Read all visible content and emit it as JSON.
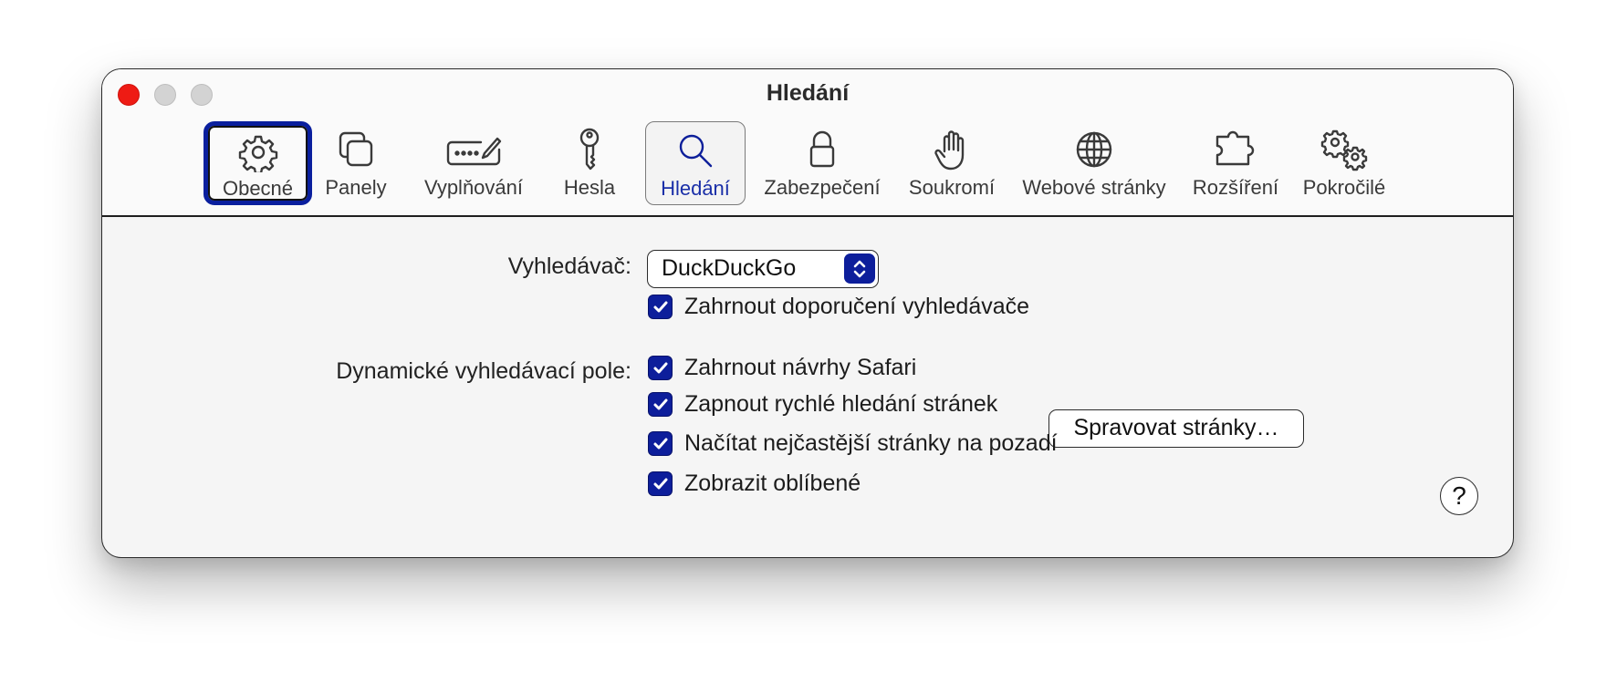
{
  "window": {
    "title": "Hledání"
  },
  "toolbar": {
    "tabs": [
      {
        "label": "Obecné",
        "icon": "gear-icon"
      },
      {
        "label": "Panely",
        "icon": "tabs-icon"
      },
      {
        "label": "Vyplňování",
        "icon": "autofill-icon"
      },
      {
        "label": "Hesla",
        "icon": "key-icon"
      },
      {
        "label": "Hledání",
        "icon": "magnifier-icon"
      },
      {
        "label": "Zabezpečení",
        "icon": "lock-icon"
      },
      {
        "label": "Soukromí",
        "icon": "hand-icon"
      },
      {
        "label": "Webové stránky",
        "icon": "globe-icon"
      },
      {
        "label": "Rozšíření",
        "icon": "puzzle-icon"
      },
      {
        "label": "Pokročilé",
        "icon": "gears-icon"
      }
    ],
    "selected_tab": "Hledání",
    "focused_tab": "Obecné"
  },
  "search": {
    "engine_label": "Vyhledávač:",
    "engine_value": "DuckDuckGo",
    "suggestions_label": "Zahrnout doporučení vyhledávače",
    "smart_field_label": "Dynamické vyhledávací pole:",
    "options": [
      {
        "label": "Zahrnout návrhy Safari",
        "checked": true
      },
      {
        "label": "Zapnout rychlé hledání stránek",
        "checked": true
      },
      {
        "label": "Načítat nejčastější stránky na pozadí",
        "checked": true
      },
      {
        "label": "Zobrazit oblíbené",
        "checked": true
      }
    ],
    "manage_button": "Spravovat stránky…",
    "help_button": "?"
  },
  "colors": {
    "accent": "#0d1e9b",
    "close": "#ee1b14"
  }
}
